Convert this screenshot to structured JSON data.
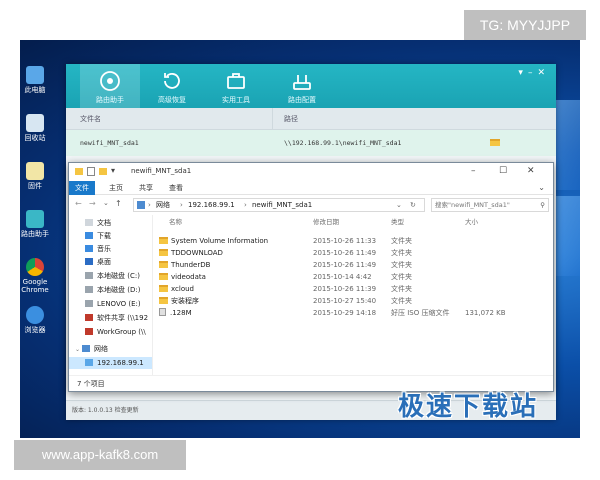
{
  "watermarks": {
    "tg": "TG: MYYJJPP",
    "site": "www.app-kafk8.com",
    "brand": "极速下载站"
  },
  "desktop_icons": [
    {
      "label": "此电脑",
      "icon": "computer-icon"
    },
    {
      "label": "回收站",
      "icon": "recycle-bin-icon"
    },
    {
      "label": "固件",
      "icon": "folder-icon"
    },
    {
      "label": "路由助手",
      "icon": "router-helper-icon"
    },
    {
      "label": "Google Chrome",
      "icon": "chrome-icon"
    },
    {
      "label": "浏览器",
      "icon": "browser-icon"
    }
  ],
  "router": {
    "tabs": [
      {
        "label": "路由助手",
        "icon": "router-helper-icon"
      },
      {
        "label": "高级恢复",
        "icon": "restore-icon"
      },
      {
        "label": "实用工具",
        "icon": "toolbox-icon"
      },
      {
        "label": "路由配置",
        "icon": "router-config-icon"
      }
    ],
    "columns": {
      "name": "文件名",
      "path": "路径"
    },
    "row": {
      "name": "newifi_MNT_sda1",
      "path": "\\\\192.168.99.1\\newifi_MNT_sda1"
    },
    "status": "版本: 1.0.0.13   检查更新"
  },
  "explorer": {
    "title": "newifi_MNT_sda1",
    "ribbon": [
      "文件",
      "主页",
      "共享",
      "查看"
    ],
    "address": [
      "网络",
      "192.168.99.1",
      "newifi_MNT_sda1"
    ],
    "search_placeholder": "搜索\"newifi_MNT_sda1\"",
    "sidebar": [
      {
        "label": "文档",
        "icon": "document-icon"
      },
      {
        "label": "下载",
        "icon": "download-icon"
      },
      {
        "label": "音乐",
        "icon": "music-icon"
      },
      {
        "label": "桌面",
        "icon": "desktop-icon"
      },
      {
        "label": "本地磁盘 (C:)",
        "icon": "drive-icon"
      },
      {
        "label": "本地磁盘 (D:)",
        "icon": "drive-icon"
      },
      {
        "label": "LENOVO (E:)",
        "icon": "drive-icon"
      },
      {
        "label": "软件共享 (\\\\192",
        "icon": "network-drive-icon"
      },
      {
        "label": "WorkGroup (\\\\",
        "icon": "network-drive-icon"
      },
      {
        "label": "网络",
        "icon": "network-icon"
      },
      {
        "label": "192.168.99.1",
        "icon": "computer-icon"
      }
    ],
    "columns": {
      "name": "名称",
      "date": "修改日期",
      "type": "类型",
      "size": "大小"
    },
    "files": [
      {
        "name": "System Volume Information",
        "date": "2015-10-26 11:33",
        "type": "文件夹",
        "size": ""
      },
      {
        "name": "TDDOWNLOAD",
        "date": "2015-10-26 11:49",
        "type": "文件夹",
        "size": ""
      },
      {
        "name": "ThunderDB",
        "date": "2015-10-26 11:49",
        "type": "文件夹",
        "size": ""
      },
      {
        "name": "videodata",
        "date": "2015-10-14 4:42",
        "type": "文件夹",
        "size": ""
      },
      {
        "name": "xcloud",
        "date": "2015-10-26 11:39",
        "type": "文件夹",
        "size": ""
      },
      {
        "name": "安装程序",
        "date": "2015-10-27 15:40",
        "type": "文件夹",
        "size": ""
      },
      {
        "name": ".128M",
        "date": "2015-10-29 14:18",
        "type": "好压 ISO 压缩文件",
        "size": "131,072 KB"
      }
    ],
    "status": "7 个项目"
  },
  "colors": {
    "router_teal": "#1aa3b3",
    "explorer_file_tab": "#1979ca",
    "desktop_blue": "#0b4fa8",
    "folder_yellow": "#f5c542"
  }
}
